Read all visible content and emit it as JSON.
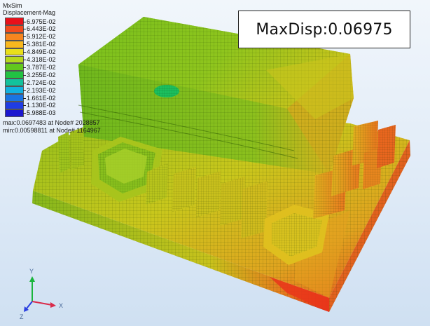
{
  "legend": {
    "app_name": "MxSim",
    "result_type": "Displacement-Mag",
    "levels": [
      {
        "label": "6.975E-02",
        "color": "#e8101a"
      },
      {
        "label": "6.443E-02",
        "color": "#f24a1c"
      },
      {
        "label": "5.912E-02",
        "color": "#f7861f"
      },
      {
        "label": "5.381E-02",
        "color": "#f9b81e"
      },
      {
        "label": "4.849E-02",
        "color": "#e9df1a"
      },
      {
        "label": "4.318E-02",
        "color": "#b6d81c"
      },
      {
        "label": "3.787E-02",
        "color": "#62c81e"
      },
      {
        "label": "3.255E-02",
        "color": "#22c243"
      },
      {
        "label": "2.724E-02",
        "color": "#13c29c"
      },
      {
        "label": "2.193E-02",
        "color": "#12b2df"
      },
      {
        "label": "1.661E-02",
        "color": "#1a74e2"
      },
      {
        "label": "1.130E-02",
        "color": "#1f3ce4"
      },
      {
        "label": "5.988E-03",
        "color": "#1a16cf"
      }
    ],
    "max_text": "max:0.0697483  at Node# 2028857",
    "min_text": "min:0.00598811  at Node# 1164967"
  },
  "annotation": {
    "max_disp_label": "MaxDisp:0.06975"
  },
  "triad": {
    "x_label": "X",
    "y_label": "Y",
    "z_label": "Z"
  }
}
